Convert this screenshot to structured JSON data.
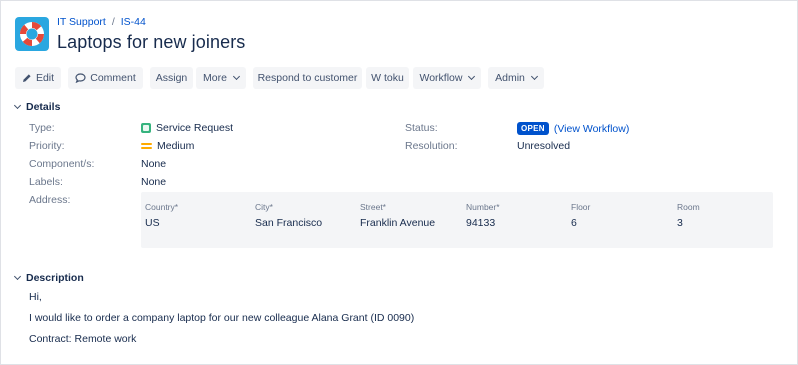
{
  "header": {
    "project": "IT Support",
    "separator": "/",
    "issue_key": "IS-44",
    "title": "Laptops for new joiners"
  },
  "toolbar": {
    "edit": "Edit",
    "comment": "Comment",
    "assign": "Assign",
    "more": "More",
    "respond": "Respond to customer",
    "wtoku": "W toku",
    "workflow": "Workflow",
    "admin": "Admin"
  },
  "details": {
    "heading": "Details",
    "type_label": "Type:",
    "type_value": "Service Request",
    "priority_label": "Priority:",
    "priority_value": "Medium",
    "components_label": "Component/s:",
    "components_value": "None",
    "labels_label": "Labels:",
    "labels_value": "None",
    "address_label": "Address:",
    "status_label": "Status:",
    "status_badge": "OPEN",
    "status_link": "(View Workflow)",
    "resolution_label": "Resolution:",
    "resolution_value": "Unresolved"
  },
  "address": {
    "headers": [
      "Country*",
      "City*",
      "Street*",
      "Number*",
      "Floor",
      "Room"
    ],
    "values": [
      "US",
      "San Francisco",
      "Franklin Avenue",
      "94133",
      "6",
      "3"
    ]
  },
  "description": {
    "heading": "Description",
    "lines": [
      "Hi,",
      "I would like to order a company laptop for our new colleague Alana Grant (ID 0090)",
      "Contract: Remote work"
    ]
  },
  "colors": {
    "link": "#0052cc",
    "status_badge": "#0052cc",
    "logo_bg": "#2aa7e0",
    "service_request_icon": "#36b37e",
    "priority_medium": "#ffab00"
  },
  "icons": {
    "logo": "lifebuoy-icon",
    "edit": "pencil-icon",
    "comment": "speech-bubble-icon",
    "dropdown": "chevron-down-icon"
  }
}
